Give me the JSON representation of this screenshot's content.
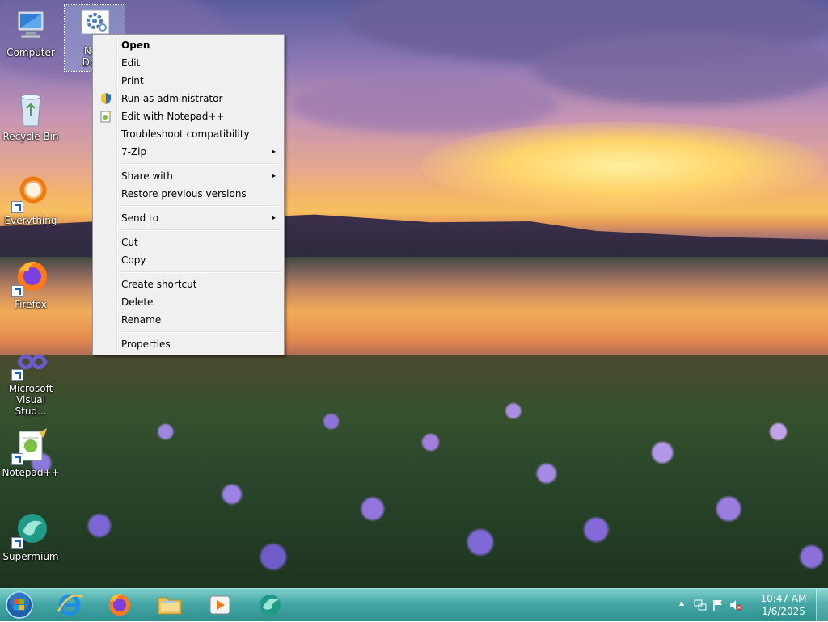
{
  "desktop": {
    "icons": [
      {
        "label": "Computer"
      },
      {
        "label": "New Document",
        "label_visible": "New\nDocu"
      },
      {
        "label": "Recycle Bin"
      },
      {
        "label": "Everything"
      },
      {
        "label": "Firefox"
      },
      {
        "label": "Microsoft Visual Stud..."
      },
      {
        "label": "Notepad++"
      },
      {
        "label": "Supermium"
      }
    ]
  },
  "context_menu": {
    "groups": [
      [
        {
          "label": "Open",
          "bold": true
        },
        {
          "label": "Edit"
        },
        {
          "label": "Print"
        },
        {
          "label": "Run as administrator",
          "icon": "uac-shield-icon"
        },
        {
          "label": "Edit with Notepad++",
          "icon": "notepadpp-icon"
        },
        {
          "label": "Troubleshoot compatibility"
        },
        {
          "label": "7-Zip",
          "submenu": true
        }
      ],
      [
        {
          "label": "Share with",
          "submenu": true
        },
        {
          "label": "Restore previous versions"
        }
      ],
      [
        {
          "label": "Send to",
          "submenu": true
        }
      ],
      [
        {
          "label": "Cut"
        },
        {
          "label": "Copy"
        }
      ],
      [
        {
          "label": "Create shortcut"
        },
        {
          "label": "Delete"
        },
        {
          "label": "Rename"
        }
      ],
      [
        {
          "label": "Properties"
        }
      ]
    ],
    "submenu_arrow": "▸"
  },
  "taskbar": {
    "pinned": [
      "start-orb-icon",
      "internet-explorer-icon",
      "firefox-icon",
      "file-explorer-icon",
      "media-player-icon",
      "supermium-icon"
    ],
    "tray": {
      "overflow_arrow": "▲",
      "icons": [
        "network-icon",
        "action-center-flag-icon",
        "volume-muted-icon"
      ],
      "time": "10:47 AM",
      "date": "1/6/2025"
    }
  },
  "colors": {
    "taskbar": "#3fa3a2",
    "menu_bg": "#f0f0f0",
    "selection": "#aac8f0"
  }
}
